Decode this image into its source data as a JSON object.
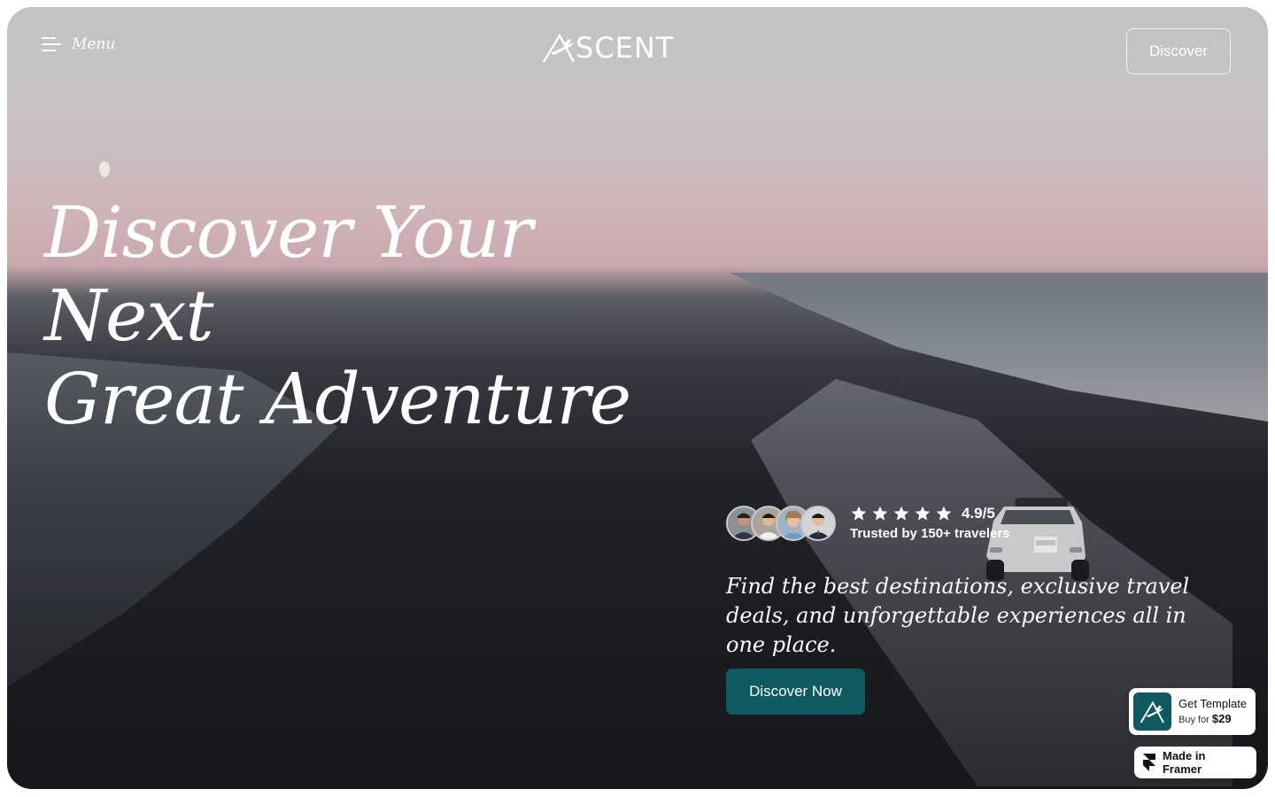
{
  "header": {
    "menu_label": "Menu",
    "logo_text": "SCENT",
    "discover_label": "Discover"
  },
  "hero": {
    "headline_line1": "Discover Your Next",
    "headline_line2": "Great Adventure",
    "rating_score": "4.9/5",
    "rating_stars": 5,
    "trusted_text": "Trusted by 150+ travelers",
    "tagline": "Find the best destinations, exclusive travel deals, and unforgettable experiences all in one place.",
    "cta_label": "Discover Now"
  },
  "badges": {
    "template_title": "Get Template",
    "template_buy_prefix": "Buy for",
    "template_price": "$29",
    "framer_label": "Made in Framer"
  },
  "colors": {
    "accent": "#0f5a61",
    "text_light": "#ffffff"
  }
}
